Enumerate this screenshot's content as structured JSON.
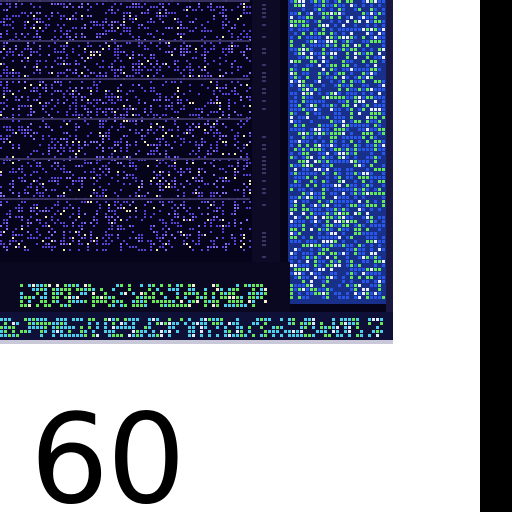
{
  "figure": {
    "caption_number": "60",
    "colors": {
      "substrate": "#06041a",
      "logic_purple": "#5a3fd6",
      "logic_violet": "#8a6cf0",
      "highlight_cream": "#f4e6b8",
      "sram_blue": "#2a56e8",
      "sram_green": "#64e85a",
      "io_cyan": "#4ad0e8",
      "edge_bar": "#000000"
    }
  }
}
